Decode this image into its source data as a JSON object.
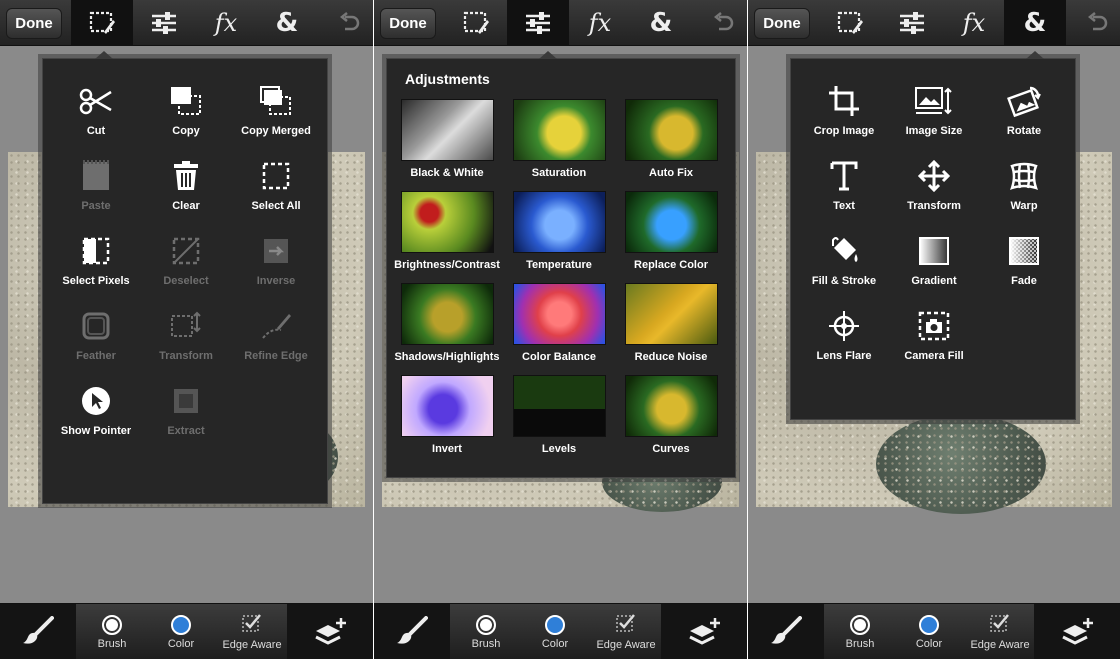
{
  "toolbar": {
    "done_label": "Done",
    "buttons": [
      "selection-icon",
      "adjustments-icon",
      "effects-icon",
      "ampersand-icon",
      "undo-icon"
    ],
    "fx_label": "fx",
    "amp_label": "&"
  },
  "selection_menu": {
    "items": [
      {
        "label": "Cut",
        "icon": "scissors-icon",
        "enabled": true
      },
      {
        "label": "Copy",
        "icon": "copy-icon",
        "enabled": true
      },
      {
        "label": "Copy Merged",
        "icon": "copy-merged-icon",
        "enabled": true
      },
      {
        "label": "Paste",
        "icon": "paste-icon",
        "enabled": false
      },
      {
        "label": "Clear",
        "icon": "trash-icon",
        "enabled": true
      },
      {
        "label": "Select All",
        "icon": "select-all-icon",
        "enabled": true
      },
      {
        "label": "Select Pixels",
        "icon": "select-pixels-icon",
        "enabled": true
      },
      {
        "label": "Deselect",
        "icon": "deselect-icon",
        "enabled": false
      },
      {
        "label": "Inverse",
        "icon": "inverse-icon",
        "enabled": false
      },
      {
        "label": "Feather",
        "icon": "feather-icon",
        "enabled": false
      },
      {
        "label": "Transform",
        "icon": "transform-selection-icon",
        "enabled": false
      },
      {
        "label": "Refine Edge",
        "icon": "refine-edge-icon",
        "enabled": false
      },
      {
        "label": "Show Pointer",
        "icon": "pointer-icon",
        "enabled": true
      },
      {
        "label": "Extract",
        "icon": "extract-icon",
        "enabled": false
      }
    ]
  },
  "adjustments_menu": {
    "title": "Adjustments",
    "items": [
      {
        "label": "Black & White"
      },
      {
        "label": "Saturation"
      },
      {
        "label": "Auto Fix"
      },
      {
        "label": "Brightness/Contrast"
      },
      {
        "label": "Temperature"
      },
      {
        "label": "Replace Color"
      },
      {
        "label": "Shadows/Highlights"
      },
      {
        "label": "Color Balance"
      },
      {
        "label": "Reduce Noise"
      },
      {
        "label": "Invert"
      },
      {
        "label": "Levels"
      },
      {
        "label": "Curves"
      }
    ]
  },
  "tools_menu": {
    "items": [
      {
        "label": "Crop Image",
        "icon": "crop-icon"
      },
      {
        "label": "Image Size",
        "icon": "image-size-icon"
      },
      {
        "label": "Rotate",
        "icon": "rotate-icon"
      },
      {
        "label": "Text",
        "icon": "text-icon"
      },
      {
        "label": "Transform",
        "icon": "transform-icon"
      },
      {
        "label": "Warp",
        "icon": "warp-icon"
      },
      {
        "label": "Fill & Stroke",
        "icon": "fill-bucket-icon"
      },
      {
        "label": "Gradient",
        "icon": "gradient-icon"
      },
      {
        "label": "Fade",
        "icon": "fade-icon"
      },
      {
        "label": "Lens Flare",
        "icon": "lens-flare-icon"
      },
      {
        "label": "Camera Fill",
        "icon": "camera-fill-icon"
      }
    ]
  },
  "bottombar": {
    "brush_label": "Brush",
    "color_label": "Color",
    "edge_aware_label": "Edge Aware",
    "color_value": "#2f7fd8"
  }
}
